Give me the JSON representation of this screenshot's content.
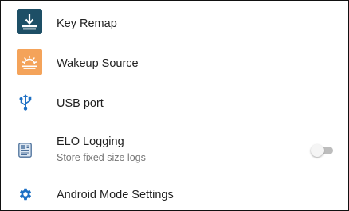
{
  "settings": {
    "items": [
      {
        "label": "Key Remap",
        "icon": "key-remap-icon"
      },
      {
        "label": "Wakeup Source",
        "icon": "wakeup-source-icon"
      },
      {
        "label": "USB port",
        "icon": "usb-icon"
      },
      {
        "label": "ELO Logging",
        "sublabel": "Store fixed size logs",
        "icon": "logging-icon",
        "toggle_on": false
      },
      {
        "label": "Android Mode Settings",
        "icon": "gear-icon"
      }
    ]
  },
  "colors": {
    "key_remap_icon_bg": "#1d4f66",
    "wakeup_icon_bg": "#f4a35a",
    "blue_icon": "#1c6fc4",
    "toggle_track_off": "#bdbdbd",
    "toggle_thumb_off": "#f5f5f5"
  }
}
